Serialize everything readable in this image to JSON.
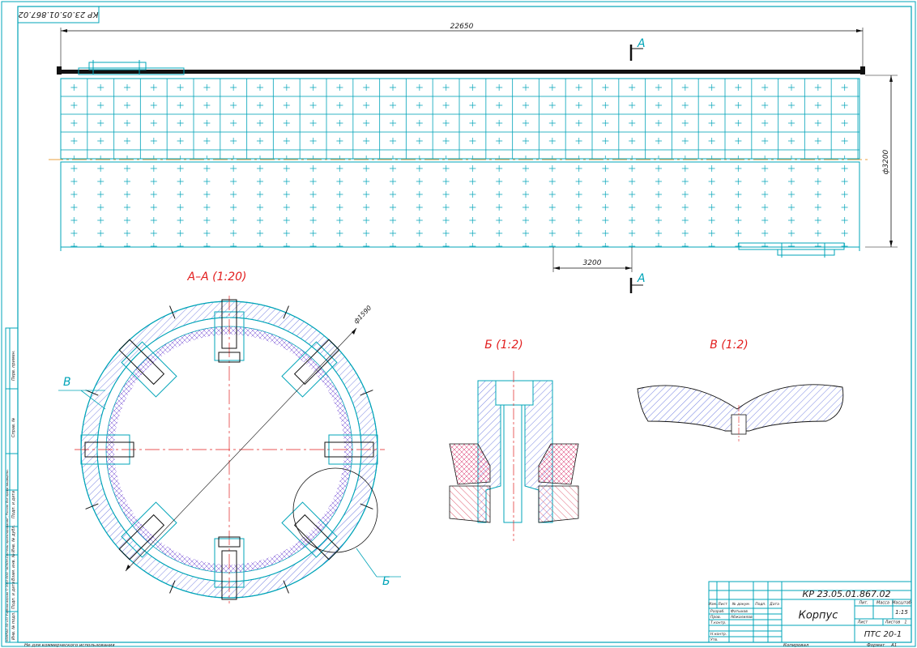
{
  "stamp": {
    "code_top": "КР 23.05.01.867.02"
  },
  "dimensions": {
    "overall_length": "22650",
    "diameter": "ф3200",
    "segment": "3200",
    "section_diameter": "ф1590"
  },
  "section_marks": {
    "a_top": "А",
    "a_bottom": "А"
  },
  "views": {
    "section_aa": "А–А (1:20)",
    "view_b": "Б (1:2)",
    "view_v": "В (1:2)",
    "callout_v": "В",
    "callout_b": "Б"
  },
  "title_block": {
    "code": "КР 23.05.01.867.02",
    "name": "Корпус",
    "org": "ПТС 20-1",
    "scale": "1:15",
    "col_lit": "Лит.",
    "col_mass": "Масса",
    "col_scale": "Масштаб",
    "sheet": "Лист",
    "sheets": "Листов",
    "sheets_n": "1",
    "row_izm": "Изм.",
    "row_list": "Лист",
    "row_docnum": "№ докум.",
    "row_podp": "Подп.",
    "row_data": "Дата",
    "razrab": "Разраб.",
    "prov": "Пров.",
    "tkontr": "Т.контр.",
    "nkontr": "Н.контр.",
    "utv": "Утв.",
    "razrab_name": "Фатыхов",
    "prov_name": "Абжалилов"
  },
  "footer": {
    "noncommercial": "Не для коммерческого использования",
    "copied": "Копировал",
    "format": "Формат",
    "format_value": "А1"
  },
  "left_strip": {
    "copyright": "КОМПАС-3D v21 Учебная версия © 2022 ООО \"АСКОН-Системы проектирования\", Россия. Все права защищены.",
    "perv_primen": "Перв. примен.",
    "sprav": "Справ. №",
    "podp_data1": "Подп. и дата",
    "inv_dubl": "Инв. № дубл.",
    "vzam_inv": "Взам. инв. №",
    "podp_data2": "Подп. и дата",
    "inv_podl": "Инв. № подл."
  }
}
